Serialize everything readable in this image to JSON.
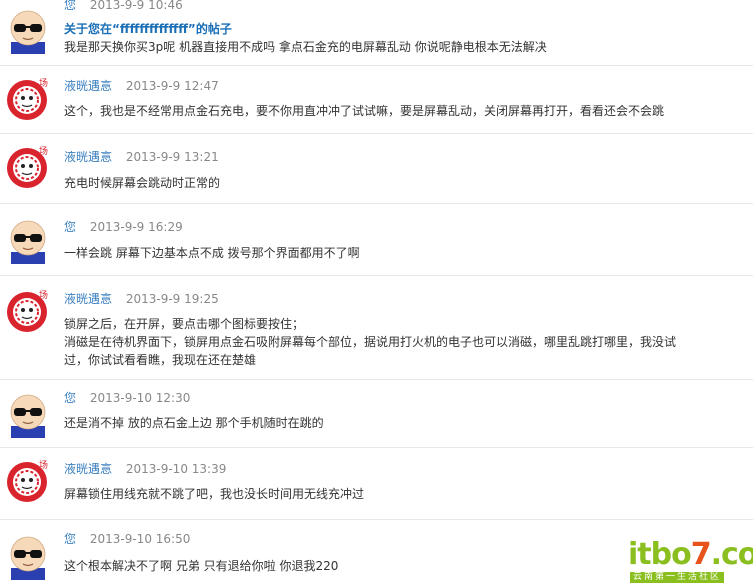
{
  "messages": [
    {
      "avatar": "bald-sunglasses-avatar",
      "author": "您",
      "time": "2013-9-9 10:46",
      "ref": "关于您在“ffffffffffffff”的帖子",
      "lines": [
        "我是那天换你买3p呢 机器直接用不成吗 拿点石金充的电屏幕乱动 你说呢静电根本无法解决"
      ]
    },
    {
      "avatar": "red-circle-avatar",
      "author": "液晄遇悥",
      "time": "2013-9-9 12:47",
      "lines": [
        "这个，我也是不经常用点金石充电，要不你用直冲冲了试试嘛，要是屏幕乱动，关闭屏幕再打开，看看还会不会跳"
      ]
    },
    {
      "avatar": "red-circle-avatar",
      "author": "液晄遇悥",
      "time": "2013-9-9 13:21",
      "lines": [
        "充电时候屏幕会跳动时正常的"
      ]
    },
    {
      "avatar": "bald-sunglasses-avatar",
      "author": "您",
      "time": "2013-9-9 16:29",
      "lines": [
        "一样会跳 屏幕下边基本点不成 拨号那个界面都用不了啊"
      ]
    },
    {
      "avatar": "red-circle-avatar",
      "author": "液晄遇悥",
      "time": "2013-9-9 19:25",
      "lines": [
        "锁屏之后，在开屏，要点击哪个图标要按住；",
        "消磁是在待机界面下，锁屏用点金石吸附屏幕每个部位，据说用打火机的电子也可以消磁，哪里乱跳打哪里，我没试",
        "过，你试试看看瞧，我现在还在楚雄"
      ]
    },
    {
      "avatar": "bald-sunglasses-avatar",
      "author": "您",
      "time": "2013-9-10 12:30",
      "lines": [
        "还是消不掉 放的点石金上边 那个手机随时在跳的"
      ]
    },
    {
      "avatar": "red-circle-avatar",
      "author": "液晄遇悥",
      "time": "2013-9-10 13:39",
      "lines": [
        "屏幕锁住用线充就不跳了吧，我也没长时间用无线充冲过"
      ]
    },
    {
      "avatar": "bald-sunglasses-avatar",
      "author": "您",
      "time": "2013-9-10 16:50",
      "lines": [
        "这个根本解决不了啊 兄弟 只有退给你啦 你退我220"
      ]
    }
  ],
  "watermark": {
    "main_prefix": "itbo",
    "main_seven": "7",
    "main_suffix": ".com",
    "sub": "云南第一生活社区"
  },
  "colors": {
    "author": "#3a7fc0",
    "time": "#888888",
    "ref": "#1a6fb6",
    "divider": "#e8e8e8"
  }
}
